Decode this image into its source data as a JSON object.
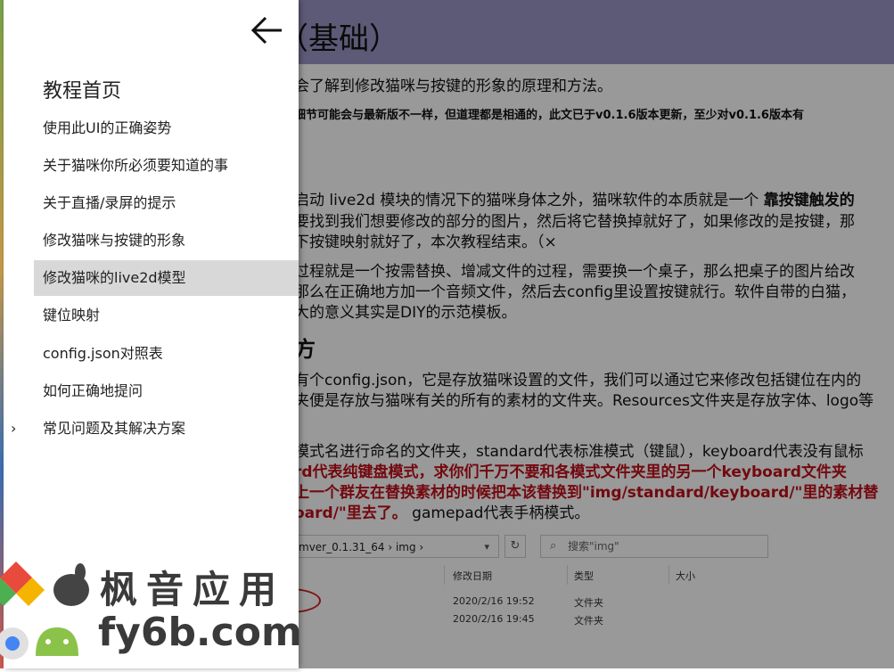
{
  "article": {
    "title_fragment": "（基础）",
    "paragraphs": [
      "会了解到修改猫咪与按键的形象的原理和方法。",
      "细节可能会与最新版不一样，但道理都是相通的，此文已于v0.1.6版本更新，至少对v0.1.6版本有",
      "启动 live2d 模块的情况下的猫咪身体之外，猫咪软件的本质就是一个 ",
      "靠按键触发的",
      "要找到我们想要修改的部分的图片，然后将它替换掉就好了，如果修改的是按键，那",
      "下按键映射就好了，本次教程结束。（×",
      "过程就是一个按需替换、增减文件的过程，需要换一个桌子，那么把桌子的图片给改",
      "那么在正确地方加一个音频文件，然后去config里设置按键就行。软件自带的白猫，",
      "大的意义其实是DIY的示范模板。",
      "有个config.json，它是存放猫咪设置的文件，我们可以通过它来修改包括键位在内的",
      "夹便是存放与猫咪有关的所有的素材的文件夹。Resources文件夹是存放字体、logo等",
      "模式名进行命名的文件夹，standard代表标准模式（键鼠），keyboard代表没有鼠标",
      "rd代表纯键盘模式，求你们千万不要和各模式文件夹里的另一个keyboard文件夹",
      "上一个群友在替换素材的时候把本该替换到\"img/standard/keyboard/\"里的素材替",
      "oard/\"里去了。",
      " gamepad代表手柄模式。"
    ],
    "section_glyph": "方",
    "explorer": {
      "path": "_mver_0.1.31_64  ›  img  ›",
      "refresh": "↻",
      "search_placeholder": "搜索\"img\"",
      "columns": [
        "修改日期",
        "类型",
        "大小"
      ],
      "rows": [
        {
          "date": "2020/2/16 19:52",
          "type": "文件夹"
        },
        {
          "date": "2020/2/16 19:45",
          "type": "文件夹"
        }
      ]
    }
  },
  "drawer": {
    "back_icon": "arrow-left-icon",
    "home_label": "教程首页",
    "items": [
      {
        "label": "使用此UI的正确姿势"
      },
      {
        "label": "关于猫咪你所必须要知道的事"
      },
      {
        "label": "关于直播/录屏的提示"
      },
      {
        "label": "修改猫咪与按键的形象"
      },
      {
        "label": "修改猫咪的live2d模型"
      },
      {
        "label": "键位映射"
      },
      {
        "label": "config.json对照表"
      },
      {
        "label": "如何正确地提问"
      },
      {
        "label": "常见问题及其解决方案"
      }
    ],
    "active_index": 4,
    "expandable_caret": "›"
  },
  "watermark": {
    "line1": "枫音应用",
    "line2": "fy6b.com"
  },
  "colors": {
    "header_bg": "#9c97c7",
    "overlay": "rgba(0,0,0,0.4)",
    "active_item_bg": "#d8d8d8",
    "red_text": "#c0101a"
  }
}
